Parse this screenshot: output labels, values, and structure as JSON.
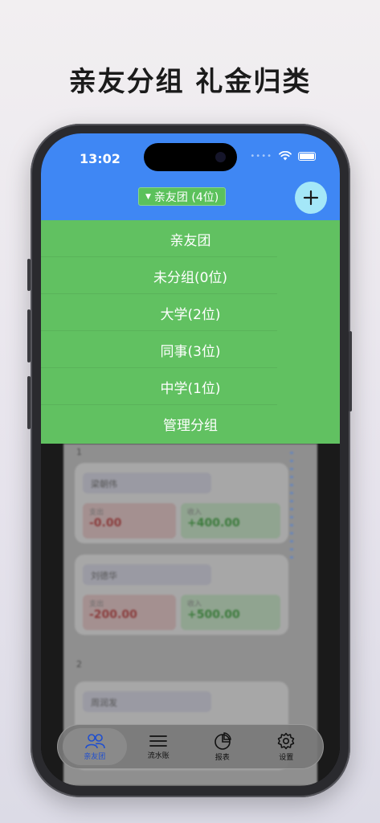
{
  "headline": "亲友分组 礼金归类",
  "status_bar": {
    "time": "13:02",
    "dots": "••••"
  },
  "header": {
    "group_selector": "亲友团 (4位)"
  },
  "dropdown": {
    "items": [
      "亲友团",
      "未分组(0位)",
      "大学(2位)",
      "同事(3位)",
      "中学(1位)",
      "管理分组"
    ]
  },
  "background": {
    "section_a": "1",
    "section_b": "2",
    "cards": [
      {
        "name": "梁朝伟",
        "out_label": "支出",
        "out_amount": "-0.00",
        "in_label": "收入",
        "in_amount": "+400.00"
      },
      {
        "name": "刘德华",
        "out_label": "支出",
        "out_amount": "-200.00",
        "in_label": "收入",
        "in_amount": "+500.00"
      },
      {
        "name": "周润发"
      }
    ]
  },
  "tab_bar": {
    "tabs": [
      {
        "label": "亲友团",
        "icon": "people-icon",
        "active": true
      },
      {
        "label": "流水账",
        "icon": "list-icon",
        "active": false
      },
      {
        "label": "报表",
        "icon": "pie-chart-icon",
        "active": false
      },
      {
        "label": "设置",
        "icon": "gear-icon",
        "active": false
      }
    ]
  },
  "colors": {
    "header_blue": "#3f87f4",
    "dropdown_green": "#61c161",
    "add_button": "#a4e7f8",
    "active_tab": "#1f4fd0"
  }
}
